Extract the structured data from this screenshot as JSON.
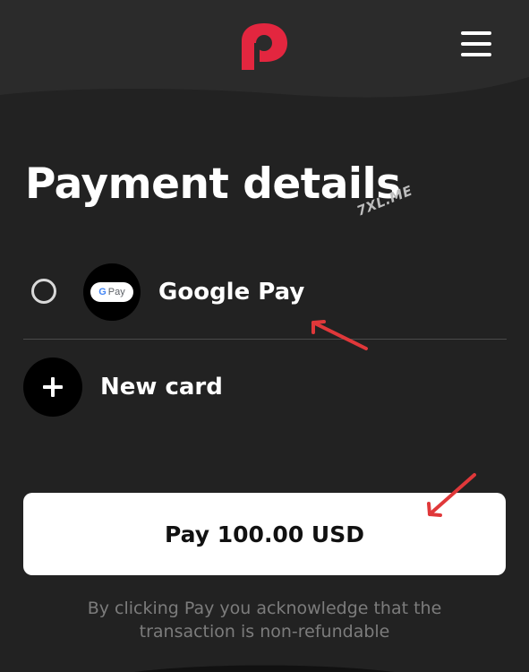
{
  "header": {
    "logo_icon": "patreon-p-logo",
    "menu_icon": "hamburger-menu-icon"
  },
  "page": {
    "title": "Payment details",
    "watermark": "7XL.ME"
  },
  "payment_options": [
    {
      "label": "Google Pay",
      "icon": "google-pay-icon",
      "icon_text": "Pay",
      "icon_letter": "G",
      "selected": false
    },
    {
      "label": "New card",
      "icon": "plus-icon"
    }
  ],
  "pay_button": {
    "label": "Pay 100.00 USD"
  },
  "disclaimer": {
    "line1": "By clicking Pay you acknowledge that the",
    "line2": "transaction is non-refundable"
  },
  "colors": {
    "background": "#222222",
    "header": "#2b2b2b",
    "brand": "#e3263f",
    "annotation_arrow": "#e0383a",
    "disclaimer_text": "#7c7c7c"
  }
}
